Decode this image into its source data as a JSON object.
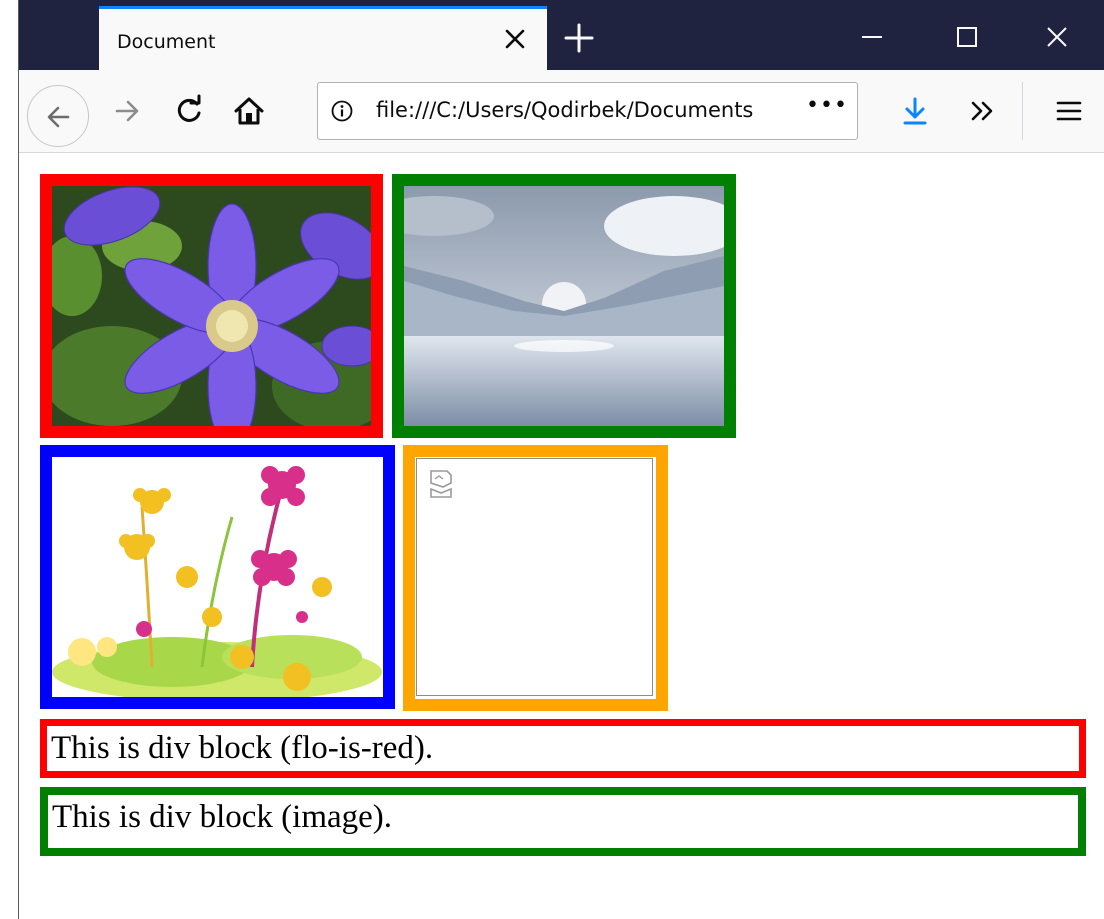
{
  "tab": {
    "title": "Document"
  },
  "address_bar": {
    "url": "file:///C:/Users/Qodirbek/Documents",
    "more_label": "•••"
  },
  "icons": [
    "back-icon",
    "forward-icon",
    "reload-icon",
    "home-icon",
    "info-icon",
    "download-icon",
    "overflow-icon",
    "menu-icon",
    "close-icon",
    "plus-icon",
    "minimize-icon",
    "maximize-icon",
    "broken-image-icon"
  ],
  "images": [
    {
      "name": "purple clematis flower",
      "border_color": "#ff0000"
    },
    {
      "name": "snowy mountain lake",
      "border_color": "#008000"
    },
    {
      "name": "clipart flower bouquet",
      "border_color": "#0000ff"
    },
    {
      "name": "broken image",
      "border_color": "#ffa500"
    }
  ],
  "blocks": [
    {
      "text": "This is div block (flo-is-red).",
      "border_color": "#ff0000"
    },
    {
      "text": "This is div block (image).",
      "border_color": "#008000"
    }
  ]
}
